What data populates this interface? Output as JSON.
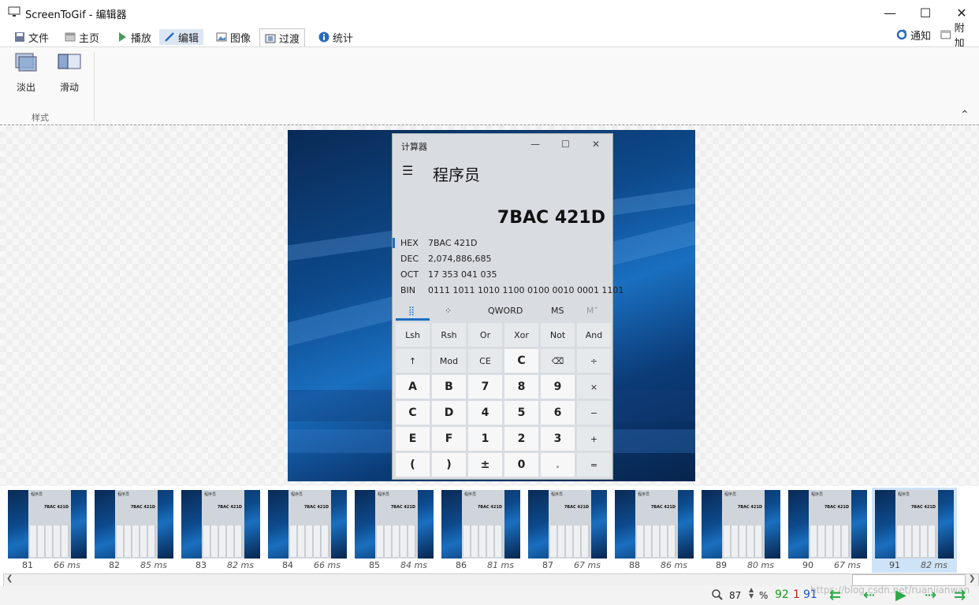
{
  "window": {
    "title": "ScreenToGif - 编辑器",
    "minimize": "—",
    "maximize": "☐",
    "close": "✕"
  },
  "tabs": [
    {
      "label": "文件"
    },
    {
      "label": "主页"
    },
    {
      "label": "播放"
    },
    {
      "label": "编辑"
    },
    {
      "label": "图像"
    },
    {
      "label": "过渡"
    },
    {
      "label": "统计"
    }
  ],
  "right_tabs": {
    "notify": "通知",
    "attach": "附加"
  },
  "ribbon": {
    "fade_label": "淡出",
    "slide_label": "滑动",
    "group_label": "样式",
    "collapse": "⌃"
  },
  "calculator": {
    "title": "计算器",
    "menu": "☰",
    "mode": "程序员",
    "display": "7BAC 421D",
    "rows": [
      {
        "label": "HEX",
        "value": "7BAC 421D"
      },
      {
        "label": "DEC",
        "value": "2,074,886,685"
      },
      {
        "label": "OCT",
        "value": "17 353 041 035"
      },
      {
        "label": "BIN",
        "value": "0111 1011 1010 1100 0100 0010 0001 1101"
      }
    ],
    "tabs": [
      "⣿",
      "⁘",
      "QWORD",
      "MS",
      "M˅"
    ],
    "keys": [
      [
        "Lsh",
        "Rsh",
        "Or",
        "Xor",
        "Not",
        "And"
      ],
      [
        "↑",
        "Mod",
        "CE",
        "C",
        "⌫",
        "÷"
      ],
      [
        "A",
        "B",
        "7",
        "8",
        "9",
        "×"
      ],
      [
        "C",
        "D",
        "4",
        "5",
        "6",
        "−"
      ],
      [
        "E",
        "F",
        "1",
        "2",
        "3",
        "+"
      ],
      [
        "(",
        ")",
        "±",
        "0",
        ".",
        "="
      ]
    ]
  },
  "frames": [
    {
      "num": "81",
      "ms": "66 ms"
    },
    {
      "num": "82",
      "ms": "85 ms"
    },
    {
      "num": "83",
      "ms": "82 ms"
    },
    {
      "num": "84",
      "ms": "66 ms"
    },
    {
      "num": "85",
      "ms": "84 ms"
    },
    {
      "num": "86",
      "ms": "81 ms"
    },
    {
      "num": "87",
      "ms": "67 ms"
    },
    {
      "num": "88",
      "ms": "86 ms"
    },
    {
      "num": "89",
      "ms": "80 ms"
    },
    {
      "num": "90",
      "ms": "67 ms"
    },
    {
      "num": "91",
      "ms": "82 ms"
    }
  ],
  "status": {
    "zoom": "87",
    "percent": "%",
    "total": "92",
    "selected": "1",
    "current": "91",
    "watermark": "https://blog.csdn.net/ruanjianwan"
  },
  "colors": {
    "accent": "#1a6fc0",
    "total": "#1a9a1a",
    "selected": "#c82020",
    "current": "#2050c8",
    "nav": "#2fa84a"
  }
}
